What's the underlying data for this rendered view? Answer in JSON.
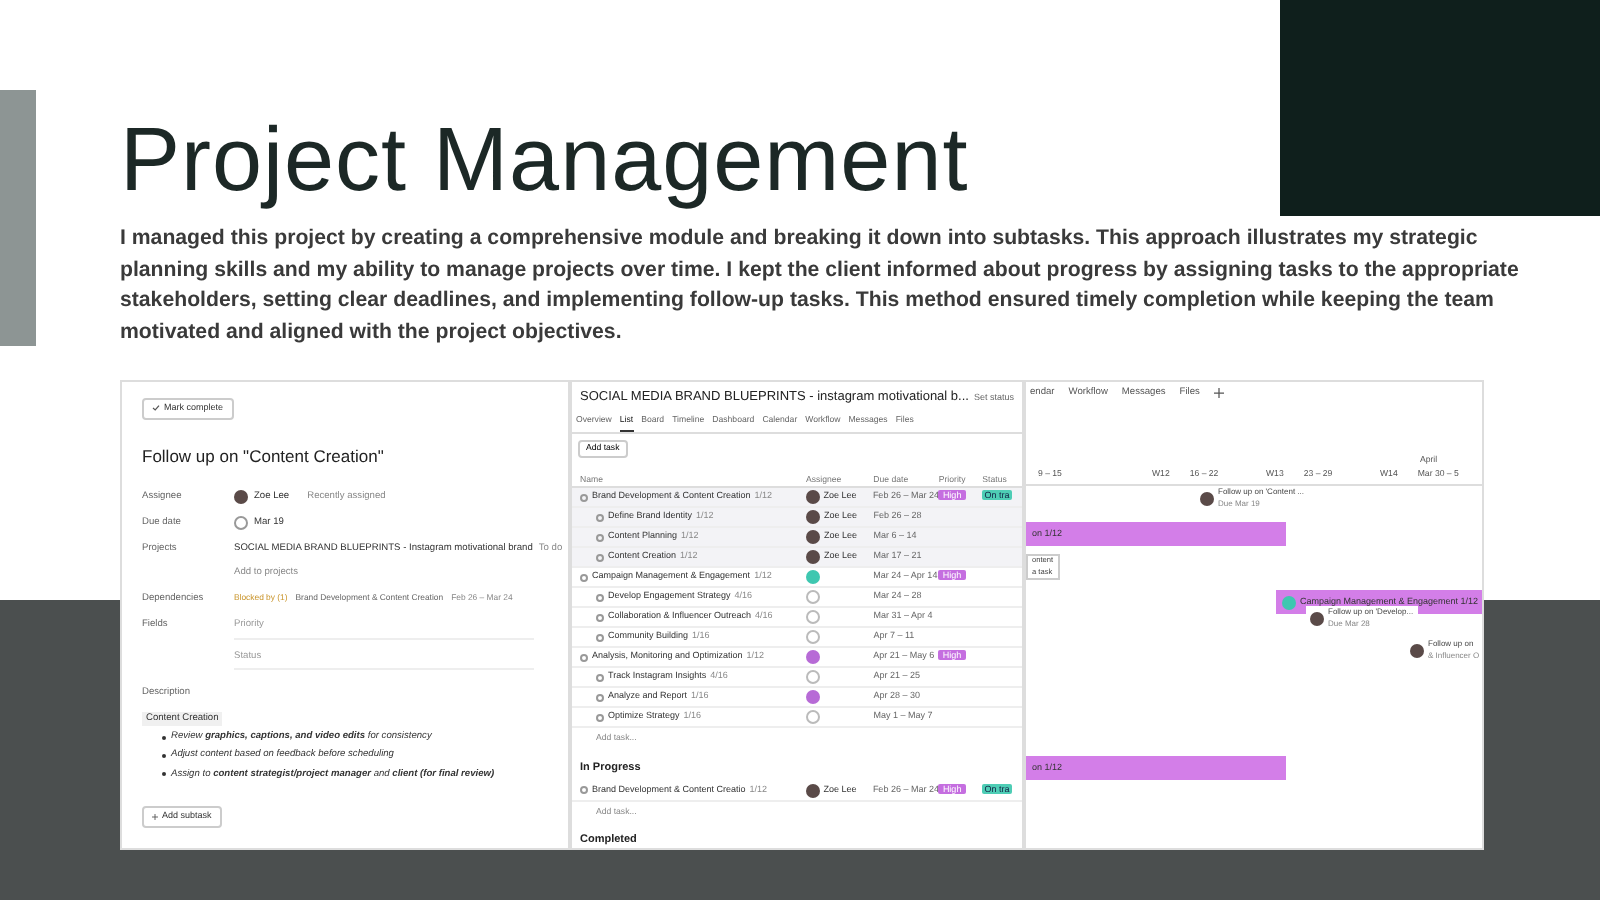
{
  "title": "Project Management",
  "description": "I managed this project by creating a comprehensive module and breaking it down into subtasks. This approach illustrates my strategic planning skills and my ability to manage projects over time. I kept the client informed about progress by assigning tasks to the appropriate stakeholders, setting clear deadlines, and implementing follow-up tasks. This method ensured timely completion while keeping the team motivated and aligned with the project objectives.",
  "task_panel": {
    "mark_complete": "Mark complete",
    "title": "Follow up on \"Content Creation\"",
    "assignee": {
      "label": "Assignee",
      "name": "Zoe Lee",
      "note": "Recently assigned"
    },
    "due_date": {
      "label": "Due date",
      "value": "Mar 19"
    },
    "projects": {
      "label": "Projects",
      "project": "SOCIAL MEDIA BRAND BLUEPRINTS - Instagram motivational brand",
      "section": "To do",
      "add": "Add to projects"
    },
    "dependencies": {
      "label": "Dependencies",
      "blocked": "Blocked by (1)",
      "task": "Brand Development & Content Creation",
      "dates": "Feb 26 – Mar 24"
    },
    "fields": {
      "label": "Fields",
      "items": [
        "Priority",
        "Status"
      ]
    },
    "description": {
      "label": "Description",
      "heading": "Content Creation",
      "bullets": [
        "Review **graphics, captions, and video edits** for consistency",
        "Adjust content based on feedback before scheduling",
        "Assign to **content strategist/project manager** and **client (for final review)**"
      ]
    },
    "add_subtask": "Add subtask"
  },
  "list_panel": {
    "project_title": "SOCIAL MEDIA BRAND BLUEPRINTS - instagram motivational b...",
    "set_status": "Set status",
    "tabs": [
      {
        "label": "Overview",
        "selected": false
      },
      {
        "label": "List",
        "selected": true
      },
      {
        "label": "Board",
        "selected": false
      },
      {
        "label": "Timeline",
        "selected": false
      },
      {
        "label": "Dashboard",
        "selected": false
      },
      {
        "label": "Calendar",
        "selected": false
      },
      {
        "label": "Workflow",
        "selected": false
      },
      {
        "label": "Messages",
        "selected": false
      },
      {
        "label": "Files",
        "selected": false
      }
    ],
    "add_task": "Add task",
    "columns": [
      "Name",
      "Assignee",
      "Due date",
      "Priority",
      "Status"
    ],
    "rows": [
      {
        "name": "Brand Development & Content Creation",
        "count": "1/12",
        "assignee": "Zoe Lee",
        "kind": "photo",
        "due": "Feb 26 – Mar 24",
        "priority": "High",
        "status": "On tra",
        "children": [
          {
            "name": "Define Brand Identity",
            "count": "1/12",
            "assignee": "Zoe Lee",
            "kind": "photo",
            "due": "Feb 26 – 28"
          },
          {
            "name": "Content Planning",
            "count": "1/12",
            "assignee": "Zoe Lee",
            "kind": "photo",
            "due": "Mar 6 – 14"
          },
          {
            "name": "Content Creation",
            "count": "1/12",
            "assignee": "Zoe Lee",
            "kind": "photo",
            "due": "Mar 17 – 21"
          }
        ]
      },
      {
        "name": "Campaign Management & Engagement",
        "count": "1/12",
        "kind": "teal",
        "due": "Mar 24 – Apr 14",
        "priority": "High",
        "children": [
          {
            "name": "Develop Engagement Strategy",
            "count": "4/16",
            "kind": "empty",
            "due": "Mar 24 – 28"
          },
          {
            "name": "Collaboration & Influencer Outreach",
            "count": "4/16",
            "kind": "empty",
            "due": "Mar 31 – Apr 4"
          },
          {
            "name": "Community Building",
            "count": "1/16",
            "kind": "empty",
            "due": "Apr 7 – 11"
          }
        ]
      },
      {
        "name": "Analysis, Monitoring and Optimization",
        "count": "1/12",
        "kind": "purple",
        "due": "Apr 21 – May 6",
        "priority": "High",
        "children": [
          {
            "name": "Track Instagram Insights",
            "count": "4/16",
            "kind": "empty",
            "due": "Apr 21 – 25"
          },
          {
            "name": "Analyze and Report",
            "count": "1/16",
            "kind": "purple",
            "due": "Apr 28 – 30"
          },
          {
            "name": "Optimize Strategy",
            "count": "1/16",
            "kind": "empty",
            "due": "May 1 – May 7"
          }
        ]
      }
    ],
    "add_task_row": "Add task...",
    "sections": [
      {
        "heading": "In Progress",
        "rows": [
          {
            "name": "Brand Development & Content Creatio",
            "count": "1/12",
            "assignee": "Zoe Lee",
            "kind": "photo",
            "due": "Feb 26 – Mar 24",
            "priority": "High",
            "status": "On tra"
          }
        ],
        "add_task_row": "Add task..."
      },
      {
        "heading": "Completed"
      }
    ]
  },
  "timeline_panel": {
    "tabs": [
      "endar",
      "Workflow",
      "Messages",
      "Files"
    ],
    "month": "April",
    "weeks": [
      {
        "dates": "9 – 15"
      },
      {
        "label": "W12",
        "dates": "16 – 22"
      },
      {
        "label": "W13",
        "dates": "23 – 29"
      },
      {
        "label": "W14",
        "dates": "Mar 30 – 5"
      }
    ],
    "bars": [
      {
        "label": "on 1/12",
        "kind": "plain"
      },
      {
        "label": "Campaign Management & Engagement 1/12",
        "kind": "avatar"
      },
      {
        "label": "on 1/12",
        "kind": "plain"
      }
    ],
    "cards": [
      {
        "title": "Follow up on 'Content ...",
        "due": "Due Mar 19"
      },
      {
        "title": "Follow up on 'Develop...",
        "due": "Due Mar 28"
      },
      {
        "title": "Follow up on",
        "due": "& Influencer O"
      }
    ],
    "popup": [
      "ontent",
      "a task"
    ]
  }
}
